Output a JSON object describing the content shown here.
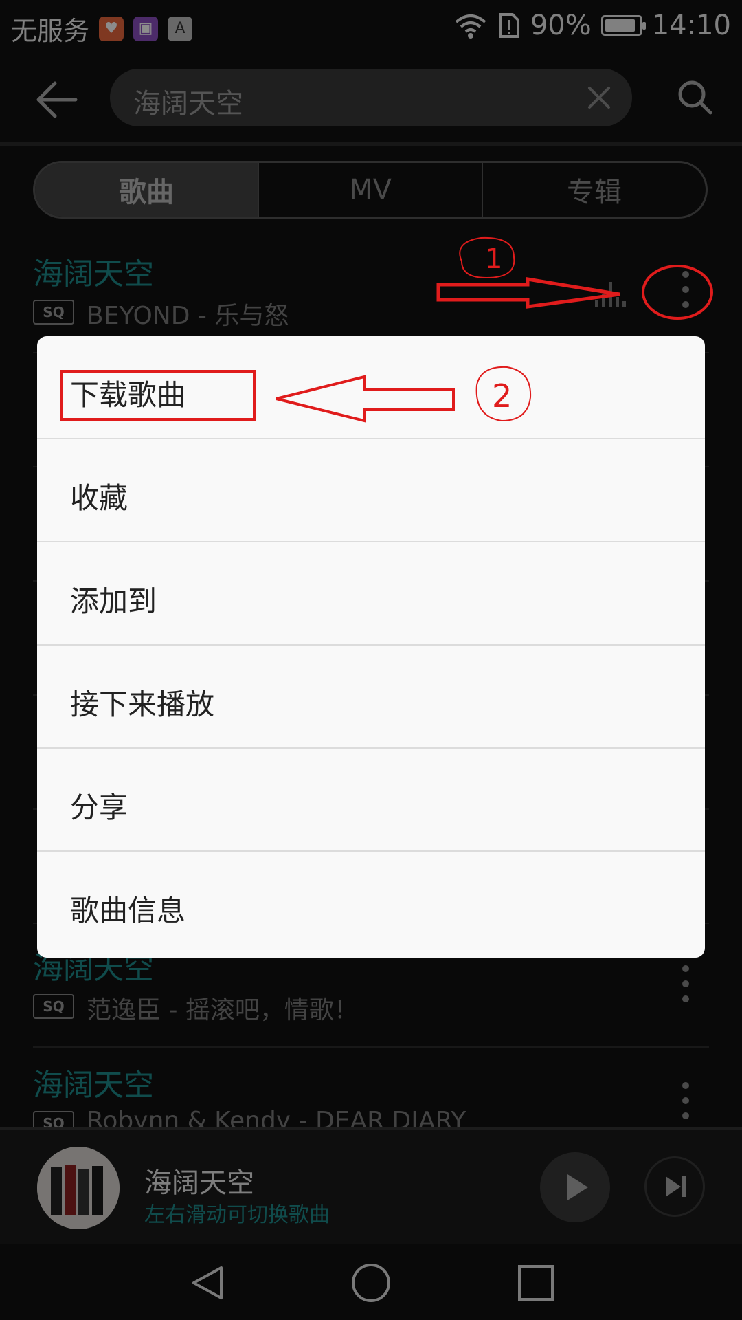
{
  "status_bar": {
    "carrier": "无服务",
    "battery_percent_label": "90%",
    "battery_level": 0.9,
    "time": "14:10",
    "app_icons": [
      "health-icon",
      "gallery-icon",
      "font-icon"
    ]
  },
  "search": {
    "query": "海阔天空"
  },
  "tabs": [
    {
      "label": "歌曲",
      "active": true
    },
    {
      "label": "MV",
      "active": false
    },
    {
      "label": "专辑",
      "active": false
    }
  ],
  "results": [
    {
      "title": "海阔天空",
      "badge": "SQ",
      "subtitle": "BEYOND - 乐与怒"
    },
    {
      "title": "海阔天空",
      "badge": "SQ",
      "subtitle": "范逸臣 - 摇滚吧，情歌！"
    },
    {
      "title": "海阔天空",
      "badge": "SQ",
      "subtitle": "Robynn & Kendy - DEAR DIARY"
    }
  ],
  "context_menu": {
    "items": [
      "下载歌曲",
      "收藏",
      "添加到",
      "接下来播放",
      "分享",
      "歌曲信息"
    ]
  },
  "player": {
    "title": "海阔天空",
    "hint": "左右滑动可切换歌曲"
  },
  "colors": {
    "accent": "#1e8a8a",
    "annotation": "#e01c1c",
    "menu_bg": "#f9f9f9"
  },
  "annotations": [
    "1",
    "2"
  ]
}
